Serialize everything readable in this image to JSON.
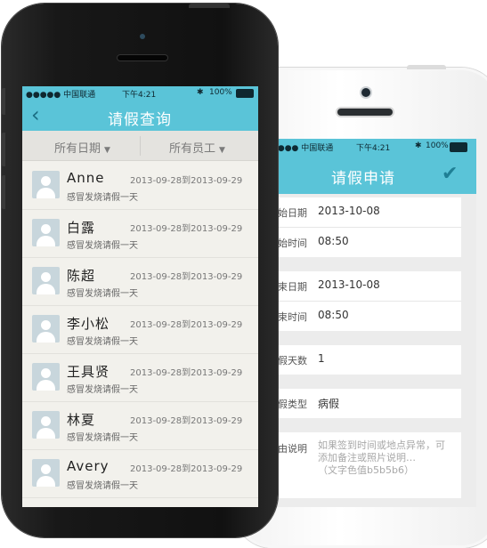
{
  "front": {
    "status": {
      "carrier": "●●●●● 中国联通",
      "time": "下午4:21",
      "battery": "100%"
    },
    "nav": {
      "title": "请假查询"
    },
    "filters": {
      "date": "所有日期",
      "employee": "所有员工"
    },
    "items": [
      {
        "name": "Anne",
        "dates": "2013-09-28到2013-09-29",
        "reason": "感冒发烧请假一天"
      },
      {
        "name": "白露",
        "dates": "2013-09-28到2013-09-29",
        "reason": "感冒发烧请假一天"
      },
      {
        "name": "陈超",
        "dates": "2013-09-28到2013-09-29",
        "reason": "感冒发烧请假一天"
      },
      {
        "name": "李小松",
        "dates": "2013-09-28到2013-09-29",
        "reason": "感冒发烧请假一天"
      },
      {
        "name": "王具贤",
        "dates": "2013-09-28到2013-09-29",
        "reason": "感冒发烧请假一天"
      },
      {
        "name": "林夏",
        "dates": "2013-09-28到2013-09-29",
        "reason": "感冒发烧请假一天"
      },
      {
        "name": "Avery",
        "dates": "2013-09-28到2013-09-29",
        "reason": "感冒发烧请假一天"
      }
    ]
  },
  "back": {
    "status": {
      "carrier": "●●●● 中国联通",
      "time": "下午4:21",
      "battery": "100%"
    },
    "nav": {
      "title": "请假申请"
    },
    "form": {
      "start_date_label": "始日期",
      "start_date": "2013-10-08",
      "start_time_label": "始时间",
      "start_time": "08:50",
      "end_date_label": "束日期",
      "end_date": "2013-10-08",
      "end_time_label": "束时间",
      "end_time": "08:50",
      "days_label": "假天数",
      "days": "1",
      "type_label": "假类型",
      "type": "病假",
      "reason_label": "由说明",
      "reason_placeholder_1": "如果签到时间或地点异常，可",
      "reason_placeholder_2": "添加备注或照片说明…",
      "reason_placeholder_3": "（文字色值b5b5b6）"
    }
  },
  "colors": {
    "accent": "#5ac4d8",
    "accent_dark": "#1a6d82"
  }
}
